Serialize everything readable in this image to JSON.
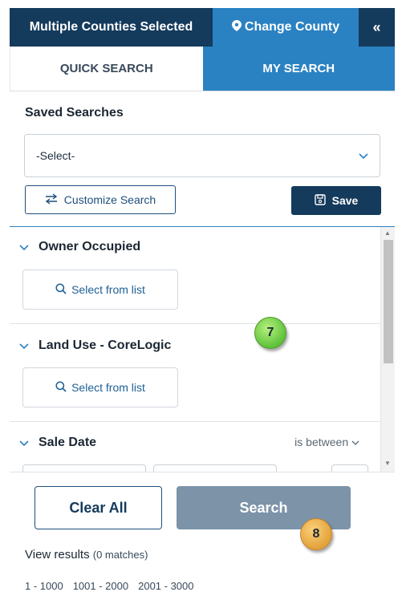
{
  "header": {
    "title": "Multiple Counties Selected",
    "change_county": "Change County",
    "collapse_icon": "«"
  },
  "tabs": [
    {
      "label": "QUICK SEARCH",
      "active": false
    },
    {
      "label": "MY SEARCH",
      "active": true
    }
  ],
  "saved": {
    "label": "Saved Searches",
    "select_value": "-Select-",
    "customize_label": "Customize Search",
    "save_label": "Save"
  },
  "sections": [
    {
      "title": "Owner Occupied",
      "picker": "Select from list"
    },
    {
      "title": "Land Use - CoreLogic",
      "picker": "Select from list"
    },
    {
      "title": "Sale Date",
      "operator": "is between"
    }
  ],
  "actions": {
    "clear_label": "Clear All",
    "search_label": "Search"
  },
  "results": {
    "label": "View results",
    "count": "(0 matches)",
    "pages": [
      "1 - 1000",
      "1001 - 2000",
      "2001 - 3000"
    ]
  },
  "markers": {
    "m1": "7",
    "m2": "8"
  },
  "colors": {
    "navy": "#143a5c",
    "accent": "#2b82c2",
    "search_disabled": "#7c93a8",
    "marker_green": "#5ec23a",
    "marker_gold": "#e3a23a"
  }
}
